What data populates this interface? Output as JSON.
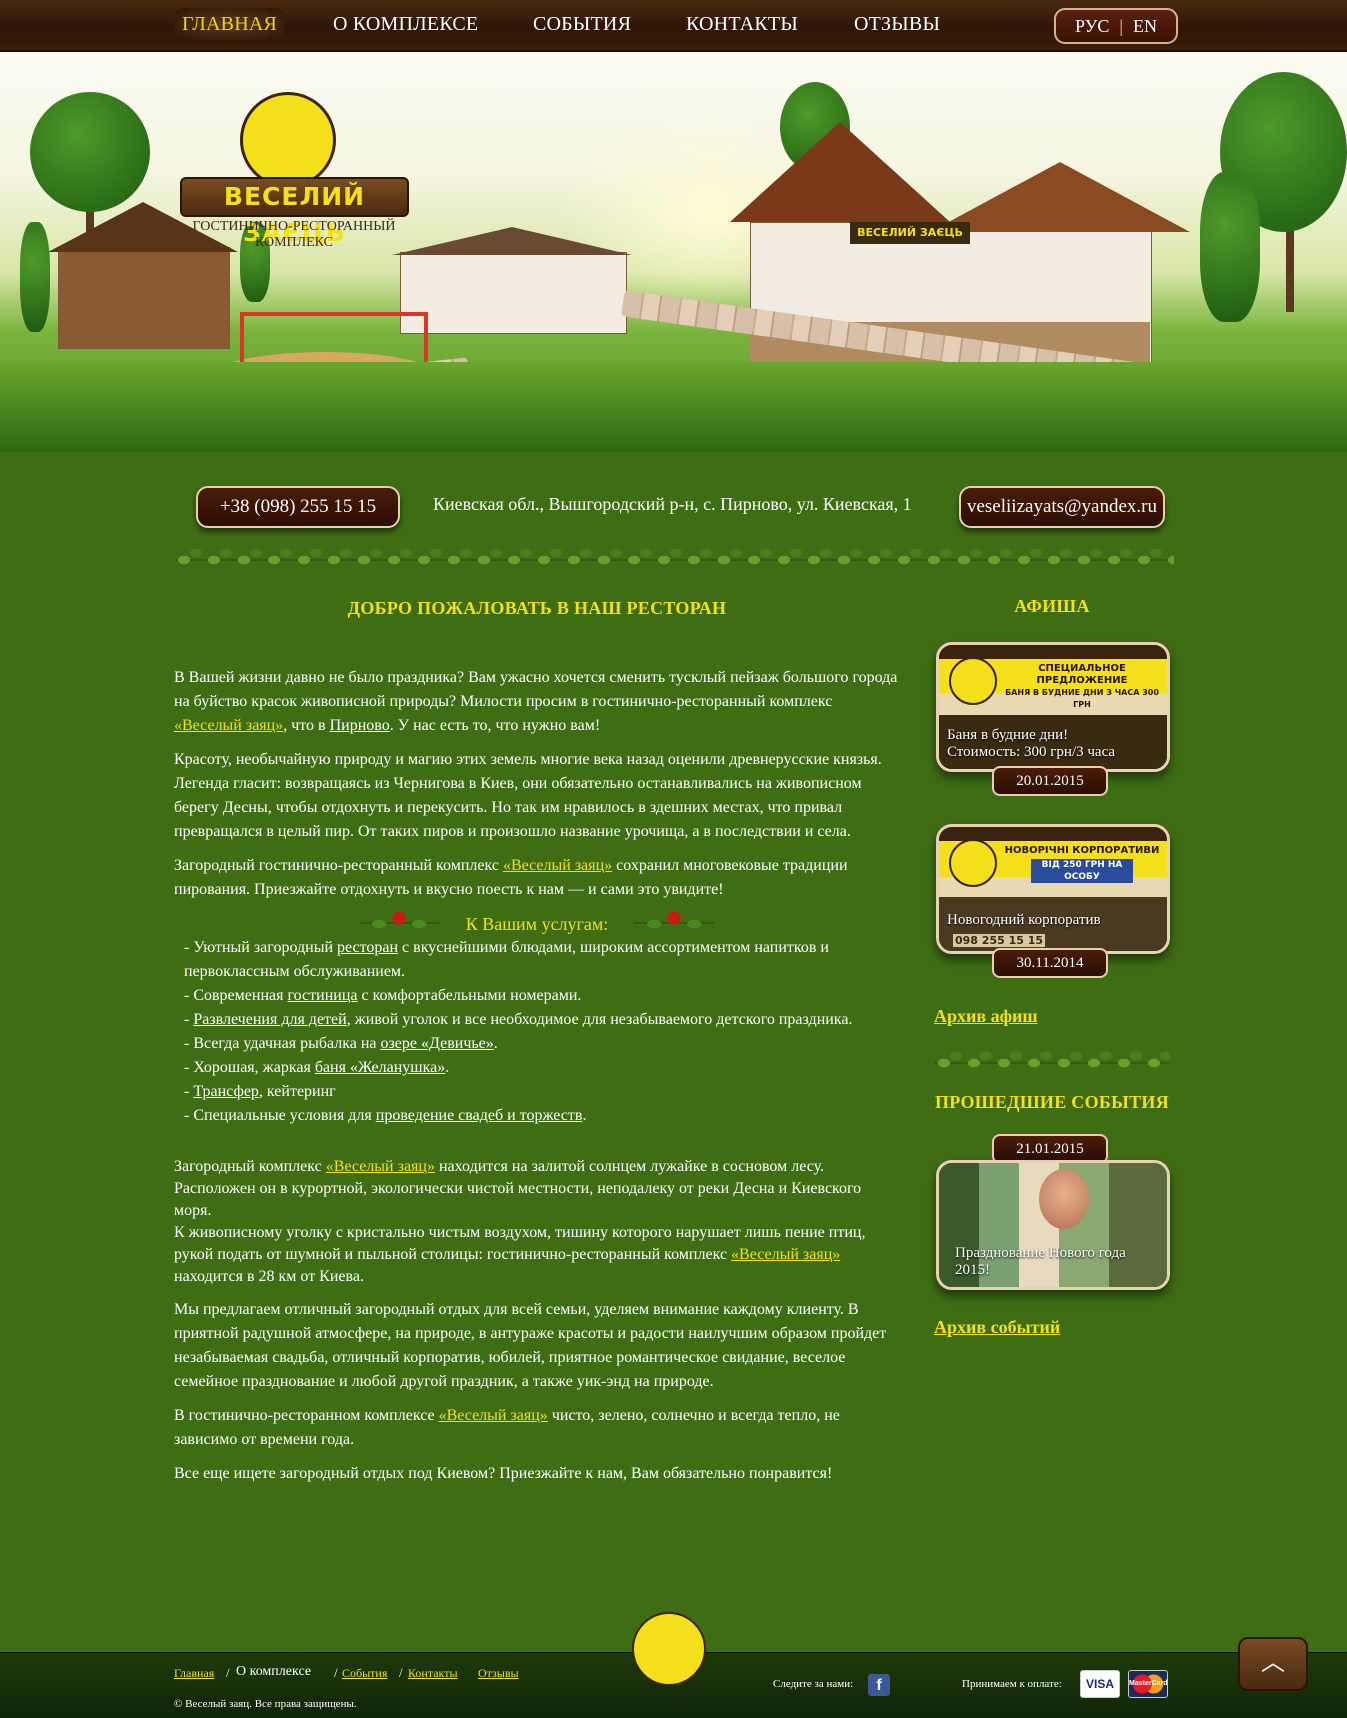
{
  "nav": {
    "items": [
      "ГЛАВНАЯ",
      "О КОМПЛЕКСЕ",
      "СОБЫТИЯ",
      "КОНТАКТЫ",
      "ОТЗЫВЫ"
    ],
    "lang_ru": "РУС",
    "lang_sep": "|",
    "lang_en": "EN"
  },
  "logo": {
    "name": "ВЕСЕЛИЙ ЗАЄЦЬ",
    "subtitle_1": "ГОСТИНИЧНО-РЕСТОРАННЫЙ",
    "subtitle_2": "КОМПЛЕКС"
  },
  "contacts": {
    "phone": "+38 (098) 255 15 15",
    "address": "Киевская обл., Вышгородский р-н, с. Пирново, ул. Киевская, 1",
    "email": "veseliizayats@yandex.ru"
  },
  "main": {
    "title": "ДОБРО ПОЖАЛОВАТЬ В НАШ РЕСТОРАН",
    "p1_a": "В Вашей жизни давно не было праздника? Вам ужасно хочется сменить тусклый пейзаж большого города на буйство красок живописной природы? Милости просим в гостинично-ресторанный комплекс ",
    "p1_link": "«Веселый заяц»",
    "p1_b": ", что в ",
    "p1_link2": "Пирново",
    "p1_c": ". У нас есть то, что нужно вам!",
    "p2": "Красоту, необычайную природу и магию этих земель многие века назад оценили древнерусские князья. Легенда гласит: возвращаясь из Чернигова в Киев, они обязательно останавливались на живописном берегу Десны, чтобы отдохнуть и перекусить. Но так им нравилось в здешних местах, что привал превращался в целый пир. От таких пиров и произошло название урочища, а в последствии и села.",
    "p3_a": "Загородный гостинично-ресторанный комплекс ",
    "p3_link": "«Веселый заяц»",
    "p3_b": " сохранил многовековые традиции пирования. Приезжайте отдохнуть и вкусно поесть к нам — и сами это увидите!",
    "services_title": "К Вашим услугам:",
    "s1_a": "- Уютный загородный ",
    "s1_link": "ресторан",
    "s1_b": " с вкуснейшими блюдами, широким ассортиментом напитков и первоклассным обслуживанием.",
    "s2_a": "- Современная ",
    "s2_link": "гостиница",
    "s2_b": " с комфортабельными номерами.",
    "s3_a": "- ",
    "s3_link": "Развлечения для детей",
    "s3_b": ", живой уголок и все необходимое для незабываемого детского праздника.",
    "s4_a": "- Всегда удачная рыбалка на ",
    "s4_link": "озере «Девичье»",
    "s4_b": ".",
    "s5_a": "- Хорошая, жаркая ",
    "s5_link": "баня «Желанушка»",
    "s5_b": ".",
    "s6_a": "- ",
    "s6_link": "Трансфер",
    "s6_b": ", кейтеринг",
    "s7_a": "- Специальные условия для ",
    "s7_link": "проведение свадеб и торжеств",
    "s7_b": ".",
    "p4_a": "Загородный комплекс ",
    "p4_link": "«Веселый заяц»",
    "p4_b": " находится на залитой солнцем лужайке в сосновом лесу. Расположен он в курортной, экологически чистой местности, неподалеку от реки Десна и Киевского моря.",
    "p4_c": "К живописному уголку с кристально чистым воздухом, тишину которого нарушает лишь пение птиц, рукой подать от шумной и пыльной столицы: гостинично-ресторанный комплекс ",
    "p4_link2": "«Веселый заяц»",
    "p4_d": " находится в 28 км от Киева.",
    "p5": "Мы предлагаем отличный загородный отдых для всей семьи, уделяем внимание каждому клиенту. В приятной радушной атмосфере, на природе, в антураже красоты и радости наилучшим образом пройдет незабываемая свадьба, отличный корпоратив, юбилей, приятное романтическое свидание, веселое семейное празднование и любой другой праздник, а также уик-энд на природе.",
    "p6_a": "В гостинично-ресторанном комплексе ",
    "p6_link": "«Веселый заяц»",
    "p6_b": " чисто, зелено, солнечно и всегда тепло, не зависимо от времени года.",
    "p7": "Все еще ищете загородный отдых под Киевом? Приезжайте к нам, Вам обязательно понравится!"
  },
  "sidebar": {
    "afisha_title": "АФИША",
    "card1": {
      "banner_line1": "СПЕЦИАЛЬНОЕ ПРЕДЛОЖЕНИЕ",
      "banner_line2": "БАНЯ В БУДНИЕ ДНИ З ЧАСА 300 ГРН",
      "caption1": "Баня в будние дни!",
      "caption2": "Стоимость: 300 грн/3 часа",
      "date": "20.01.2015"
    },
    "card2": {
      "banner_line1": "НОВОРІЧНІ КОРПОРАТИВИ",
      "banner_line2": "ВІД 250 ГРН НА ОСОБУ",
      "banner_phone": "098 255 15 15",
      "caption": "Новогодний корпоратив",
      "date": "30.11.2014"
    },
    "archive_afisha": "Архив афиш",
    "past_title": "ПРОШЕДШИЕ СОБЫТИЯ",
    "event": {
      "date": "21.01.2015",
      "caption": "Празднование Нового года 2015!"
    },
    "archive_events": "Архив событий"
  },
  "footer": {
    "links": [
      "Главная",
      "О комплексе",
      "События",
      "Контакты",
      "Отзывы"
    ],
    "copyright": "© Веселый заяц. Все права защищены.",
    "follow_label": "Следите за нами:",
    "pay_label": "Принимаем к оплате:",
    "visa": "VISA",
    "mastercard": "MasterCard"
  },
  "colors": {
    "accent_yellow": "#f4e01a",
    "bg_green": "#3f6d14",
    "wood_brown": "#2e1608"
  },
  "icons": [
    "facebook-icon",
    "up-arrow-icon"
  ]
}
